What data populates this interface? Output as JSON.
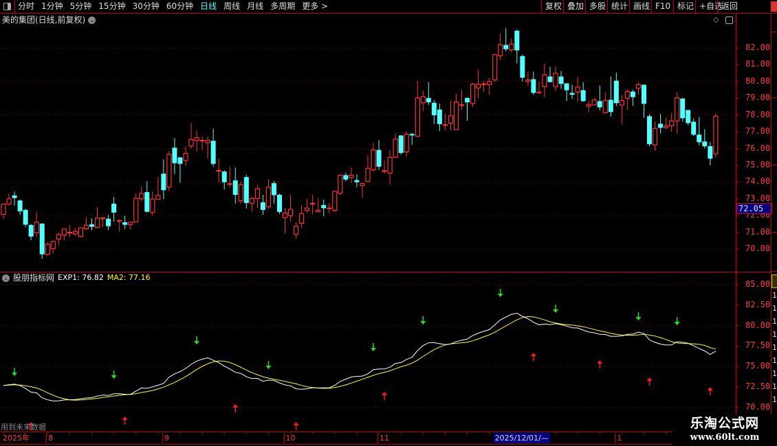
{
  "toolbar": {
    "periods": [
      {
        "label": "分时"
      },
      {
        "label": "1分钟"
      },
      {
        "label": "5分钟"
      },
      {
        "label": "15分钟"
      },
      {
        "label": "30分钟"
      },
      {
        "label": "60分钟"
      },
      {
        "label": "日线",
        "active": true
      },
      {
        "label": "周线"
      },
      {
        "label": "月线"
      },
      {
        "label": "多周期"
      },
      {
        "label": "更多 >"
      }
    ],
    "buttons": [
      {
        "label": "复权"
      },
      {
        "label": "叠加"
      },
      {
        "label": "多股"
      },
      {
        "label": "统计"
      },
      {
        "label": "画线"
      },
      {
        "label": "F10"
      },
      {
        "label": "标记"
      },
      {
        "label": "+自选"
      },
      {
        "label": "返回"
      }
    ]
  },
  "chart": {
    "title": "美的集团(日线,前复权)",
    "cursor_price": "72.05",
    "price_axis": {
      "ticks": [
        "82.00",
        "81.00",
        "80.00",
        "79.00",
        "78.00",
        "77.00",
        "76.00",
        "75.00",
        "74.00",
        "73.00",
        "72.00",
        "71.00",
        "70.00"
      ],
      "min": 70,
      "max": 82
    },
    "colors": {
      "up": "#ff3232",
      "down": "#54ffff",
      "grid": "#8b0000",
      "axis": "#c00000"
    },
    "ohlc": [
      [
        72.07,
        72.69,
        71.78,
        72.69
      ],
      [
        72.69,
        73.32,
        72.6,
        73.0
      ],
      [
        73.2,
        73.44,
        72.6,
        73.05
      ],
      [
        72.9,
        72.95,
        72.05,
        72.26
      ],
      [
        72.34,
        72.4,
        71.32,
        71.46
      ],
      [
        71.44,
        71.5,
        70.54,
        70.75
      ],
      [
        70.97,
        72.22,
        70.72,
        71.6
      ],
      [
        71.52,
        71.55,
        69.41,
        69.69
      ],
      [
        69.69,
        70.42,
        69.62,
        70.29
      ],
      [
        70.03,
        70.5,
        69.75,
        70.46
      ],
      [
        70.6,
        70.98,
        70.25,
        70.87
      ],
      [
        70.84,
        71.24,
        70.52,
        71.2
      ],
      [
        71.0,
        71.44,
        70.72,
        71.0
      ],
      [
        70.9,
        71.25,
        70.81,
        71.06
      ],
      [
        70.76,
        71.3,
        70.72,
        71.27
      ],
      [
        71.21,
        71.9,
        71.13,
        71.43
      ],
      [
        71.48,
        71.84,
        71.12,
        71.33
      ],
      [
        71.29,
        72.5,
        71.26,
        71.85
      ],
      [
        71.86,
        71.9,
        71.32,
        71.86
      ],
      [
        71.81,
        72.04,
        71.13,
        71.37
      ],
      [
        72.71,
        73.11,
        71.64,
        72.18
      ],
      [
        71.71,
        71.76,
        71.05,
        71.71
      ],
      [
        71.6,
        71.99,
        71.2,
        71.45
      ],
      [
        71.45,
        71.6,
        71.17,
        71.6
      ],
      [
        71.62,
        73.32,
        71.6,
        73.03
      ],
      [
        73.0,
        73.74,
        72.86,
        73.32
      ],
      [
        73.4,
        74.06,
        72.18,
        72.23
      ],
      [
        72.19,
        73.44,
        72.0,
        72.99
      ],
      [
        72.98,
        74.3,
        72.95,
        73.2
      ],
      [
        74.5,
        75.35,
        72.99,
        73.52
      ],
      [
        73.7,
        75.86,
        73.48,
        75.65
      ],
      [
        76.05,
        76.63,
        74.48,
        75.13
      ],
      [
        75.47,
        75.5,
        73.95,
        75.09
      ],
      [
        75.29,
        76.14,
        74.97,
        75.71
      ],
      [
        76.15,
        77.53,
        75.99,
        76.53
      ],
      [
        76.49,
        77.07,
        75.84,
        76.65
      ],
      [
        76.49,
        76.71,
        75.9,
        76.49
      ],
      [
        76.35,
        76.71,
        75.4,
        76.49
      ],
      [
        76.46,
        77.19,
        74.93,
        75.09
      ],
      [
        74.69,
        75.4,
        73.97,
        74.69
      ],
      [
        74.63,
        74.7,
        73.55,
        73.99
      ],
      [
        73.9,
        74.91,
        73.69,
        73.9
      ],
      [
        74.1,
        74.87,
        72.71,
        73.24
      ],
      [
        72.88,
        74.06,
        72.71,
        73.84
      ],
      [
        74.3,
        74.43,
        72.42,
        72.75
      ],
      [
        72.73,
        73.12,
        72.22,
        73.02
      ],
      [
        73.02,
        73.81,
        72.46,
        73.6
      ],
      [
        72.79,
        73.24,
        72.05,
        72.34
      ],
      [
        72.52,
        74.18,
        72.39,
        73.69
      ],
      [
        73.93,
        74.06,
        72.72,
        73.22
      ],
      [
        73.24,
        73.3,
        72.1,
        72.22
      ],
      [
        71.88,
        72.45,
        70.93,
        72.16
      ],
      [
        72.0,
        73.24,
        71.66,
        72.37
      ],
      [
        70.88,
        71.6,
        70.61,
        71.36
      ],
      [
        71.54,
        72.65,
        71.25,
        72.12
      ],
      [
        72.31,
        72.99,
        72.15,
        72.45
      ],
      [
        72.73,
        73.24,
        72.07,
        72.73
      ],
      [
        72.23,
        73.06,
        72.2,
        72.33
      ],
      [
        72.63,
        72.95,
        71.95,
        72.44
      ],
      [
        72.45,
        72.75,
        72.15,
        72.45
      ],
      [
        72.31,
        73.51,
        72.2,
        73.44
      ],
      [
        73.33,
        74.46,
        73.24,
        74.41
      ],
      [
        74.41,
        74.54,
        74.04,
        74.15
      ],
      [
        74.27,
        74.87,
        73.95,
        74.41
      ],
      [
        74.12,
        74.46,
        73.7,
        73.99
      ],
      [
        73.8,
        73.95,
        73.05,
        73.92
      ],
      [
        74.04,
        75.61,
        74.04,
        74.82
      ],
      [
        74.73,
        76.34,
        74.64,
        75.92
      ],
      [
        75.92,
        76.5,
        74.72,
        74.92
      ],
      [
        74.68,
        75.28,
        74.48,
        74.68
      ],
      [
        74.53,
        75.89,
        73.86,
        75.47
      ],
      [
        75.47,
        76.91,
        75.47,
        76.57
      ],
      [
        76.78,
        76.8,
        75.65,
        75.74
      ],
      [
        75.8,
        77.03,
        75.5,
        76.86
      ],
      [
        76.87,
        76.95,
        76.23,
        76.78
      ],
      [
        76.73,
        80.05,
        76.73,
        79.02
      ],
      [
        78.73,
        79.48,
        78.23,
        79.1
      ],
      [
        79.02,
        79.97,
        78.6,
        78.76
      ],
      [
        78.73,
        78.9,
        77.46,
        77.99
      ],
      [
        78.33,
        78.69,
        77.05,
        77.46
      ],
      [
        77.42,
        78.1,
        77.09,
        77.42
      ],
      [
        77.51,
        78.86,
        77.09,
        77.96
      ],
      [
        77.13,
        79.28,
        77.13,
        78.78
      ],
      [
        78.61,
        79.52,
        78.31,
        78.61
      ],
      [
        79.02,
        79.05,
        77.66,
        78.76
      ],
      [
        78.69,
        79.92,
        78.48,
        79.84
      ],
      [
        79.62,
        80.71,
        79.0,
        79.84
      ],
      [
        79.86,
        80.04,
        79.39,
        79.86
      ],
      [
        79.82,
        80.2,
        79.2,
        80.0
      ],
      [
        80.1,
        81.65,
        79.97,
        81.6
      ],
      [
        81.54,
        82.87,
        81.29,
        82.2
      ],
      [
        82.18,
        83.2,
        81.8,
        81.93
      ],
      [
        81.9,
        82.58,
        81.74,
        82.24
      ],
      [
        83.03,
        83.11,
        81.08,
        81.86
      ],
      [
        81.52,
        81.6,
        80.0,
        80.23
      ],
      [
        80.0,
        80.61,
        79.75,
        80.1
      ],
      [
        80.14,
        80.59,
        79.21,
        79.32
      ],
      [
        79.37,
        80.0,
        79.26,
        79.37
      ],
      [
        79.7,
        81.08,
        79.07,
        80.41
      ],
      [
        80.3,
        80.88,
        79.93,
        79.97
      ],
      [
        79.7,
        80.91,
        79.43,
        80.49
      ],
      [
        80.3,
        80.63,
        79.57,
        79.86
      ],
      [
        79.89,
        79.9,
        78.83,
        79.48
      ],
      [
        79.32,
        79.81,
        78.96,
        79.21
      ],
      [
        79.37,
        80.3,
        78.79,
        79.67
      ],
      [
        79.48,
        79.97,
        78.79,
        78.83
      ],
      [
        78.52,
        78.85,
        78.16,
        78.63
      ],
      [
        78.6,
        79.05,
        78.6,
        78.9
      ],
      [
        78.83,
        79.77,
        78.29,
        78.46
      ],
      [
        78.14,
        79.36,
        78.14,
        78.87
      ],
      [
        78.91,
        80.3,
        77.9,
        78.18
      ],
      [
        80.05,
        80.54,
        78.53,
        78.71
      ],
      [
        78.6,
        79.2,
        77.45,
        78.87
      ],
      [
        79.0,
        79.55,
        78.3,
        79.4
      ],
      [
        79.4,
        79.51,
        78.55,
        79.07
      ],
      [
        79.6,
        79.93,
        79.2,
        79.81
      ],
      [
        79.81,
        79.81,
        77.85,
        78.67
      ],
      [
        77.93,
        78.05,
        76.15,
        76.26
      ],
      [
        76.22,
        77.63,
        75.87,
        77.2
      ],
      [
        77.48,
        78.08,
        76.9,
        77.24
      ],
      [
        77.25,
        77.84,
        77.16,
        77.36
      ],
      [
        77.36,
        78.13,
        77.0,
        77.65
      ],
      [
        77.65,
        79.36,
        76.9,
        79.03
      ],
      [
        78.99,
        78.99,
        77.6,
        77.81
      ],
      [
        78.3,
        78.3,
        77.4,
        77.52
      ],
      [
        77.6,
        77.8,
        76.75,
        76.83
      ],
      [
        76.83,
        77.88,
        76.2,
        76.38
      ],
      [
        76.42,
        77.15,
        76.0,
        76.14
      ],
      [
        76.14,
        76.4,
        75.0,
        75.4
      ],
      [
        75.69,
        78.1,
        75.44,
        77.93
      ]
    ]
  },
  "indicator": {
    "name": "股朋指标网",
    "exp1_label": "EXP1: 76.82",
    "ma2_label": "MA2: 77.16",
    "colors": {
      "exp1": "#ffffff",
      "ma2": "#ffff00",
      "buy": "#ff1a1a",
      "sell": "#22dd22"
    },
    "axis": {
      "ticks": [
        "85.00",
        "82.50",
        "80.00",
        "77.50",
        "75.00",
        "72.50",
        "70.00"
      ],
      "min": 70,
      "max": 85
    },
    "sell_signals": [
      {
        "bar": 2,
        "value": 74.27
      },
      {
        "bar": 20,
        "value": 73.94
      },
      {
        "bar": 35,
        "value": 78.13
      },
      {
        "bar": 48,
        "value": 75.11
      },
      {
        "bar": 67,
        "value": 77.29
      },
      {
        "bar": 76,
        "value": 80.56
      },
      {
        "bar": 90,
        "value": 83.91
      },
      {
        "bar": 100,
        "value": 81.98
      },
      {
        "bar": 115,
        "value": 81.06
      },
      {
        "bar": 122,
        "value": 80.47
      }
    ],
    "buy_signals": [
      {
        "bar": 5,
        "value": 67.82
      },
      {
        "bar": 22,
        "value": 68.49
      },
      {
        "bar": 42,
        "value": 70.0
      },
      {
        "bar": 53,
        "value": 67.82
      },
      {
        "bar": 69,
        "value": 71.5
      },
      {
        "bar": 96,
        "value": 76.28
      },
      {
        "bar": 108,
        "value": 75.36
      },
      {
        "bar": 117,
        "value": 73.26
      },
      {
        "bar": 128,
        "value": 72.09
      }
    ],
    "future_data_warning": "用到未来数据",
    "right_values": [
      "1",
      "1",
      "1",
      "1",
      "1",
      "1",
      "1",
      "1",
      "1"
    ]
  },
  "time_axis": {
    "labels": [
      {
        "label": "2025年",
        "bar": 0
      },
      {
        "label": "8",
        "bar": 8
      },
      {
        "label": "9",
        "bar": 29
      },
      {
        "label": "10",
        "bar": 51
      },
      {
        "label": "11",
        "bar": 68
      },
      {
        "label": "2025/12/01/—",
        "bar": 89,
        "cursor": true
      },
      {
        "label": "1",
        "bar": 111
      }
    ]
  },
  "watermark": {
    "title": "乐淘公式网",
    "url": "www.60lt.com"
  }
}
